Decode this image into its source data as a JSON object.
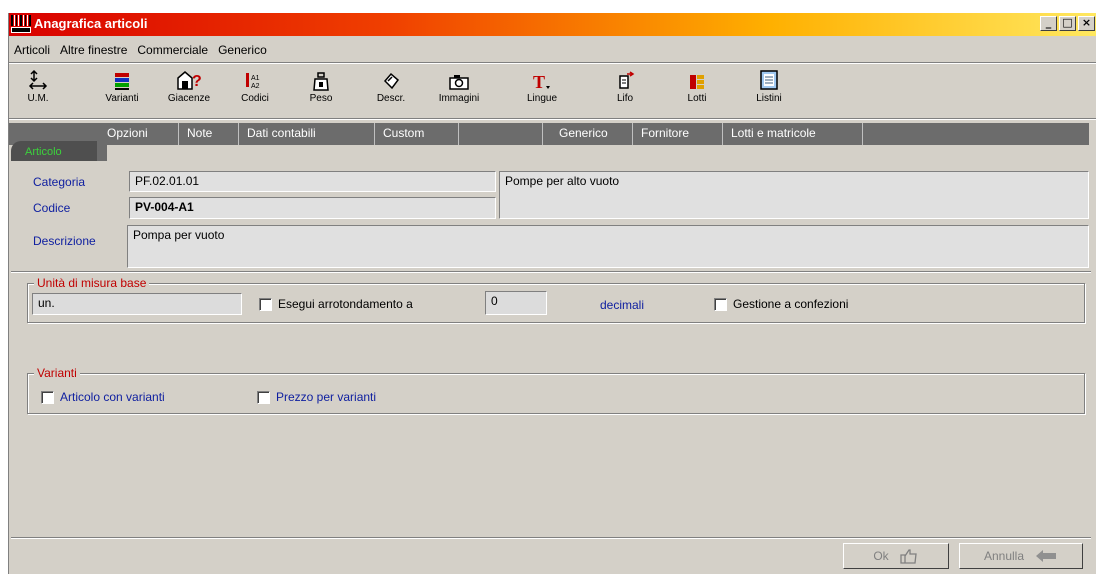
{
  "window": {
    "title": "Anagrafica articoli",
    "controls": [
      "_",
      "□",
      "×"
    ]
  },
  "menu": {
    "items": [
      "Articoli",
      "Altre finestre",
      "Commerciale",
      "Generico"
    ]
  },
  "toolbar": {
    "buttons": [
      {
        "label": "U.M.",
        "icon": "measure-arrows-icon"
      },
      {
        "label": "Varianti",
        "icon": "color-bars-icon"
      },
      {
        "label": "Giacenze",
        "icon": "warehouse-question-icon"
      },
      {
        "label": "Codici",
        "icon": "codes-icon"
      },
      {
        "label": "Peso",
        "icon": "weight-icon"
      },
      {
        "label": "Descr.",
        "icon": "description-icon"
      },
      {
        "label": "Immagini",
        "icon": "camera-icon"
      },
      {
        "label": "Lingue",
        "icon": "text-font-icon"
      },
      {
        "label": "Lifo",
        "icon": "lifo-icon"
      },
      {
        "label": "Lotti",
        "icon": "lots-icon"
      },
      {
        "label": "Listini",
        "icon": "price-list-icon"
      }
    ]
  },
  "tabs": {
    "active": "Articolo",
    "items": [
      "Opzioni",
      "Note",
      "Dati contabili",
      "Custom",
      "",
      "Generico",
      "Fornitore",
      "Lotti e matricole"
    ]
  },
  "form": {
    "categoria_label": "Categoria",
    "categoria_value": "PF.02.01.01",
    "categoria_desc": "Pompe per alto vuoto",
    "codice_label": "Codice",
    "codice_value": "PV-004-A1",
    "descrizione_label": "Descrizione",
    "descrizione_value": "Pompa per vuoto"
  },
  "um_group": {
    "title": "Unità di misura base",
    "um_value": "un.",
    "round_label": "Esegui arrotondamento a",
    "round_checked": false,
    "decimals_value": "0",
    "decimals_label": "decimali",
    "packs_label": "Gestione a confezioni",
    "packs_checked": false
  },
  "variants_group": {
    "title": "Varianti",
    "with_variants_label": "Articolo con varianti",
    "with_variants_checked": false,
    "price_variants_label": "Prezzo per varianti",
    "price_variants_checked": false
  },
  "buttons": {
    "ok": "Ok",
    "cancel": "Annulla"
  },
  "colors": {
    "tab_strip": "#6c6c6c",
    "active_tab_text": "#3cd23c",
    "group_title": "#c00000",
    "label_blue": "#1020a0"
  }
}
